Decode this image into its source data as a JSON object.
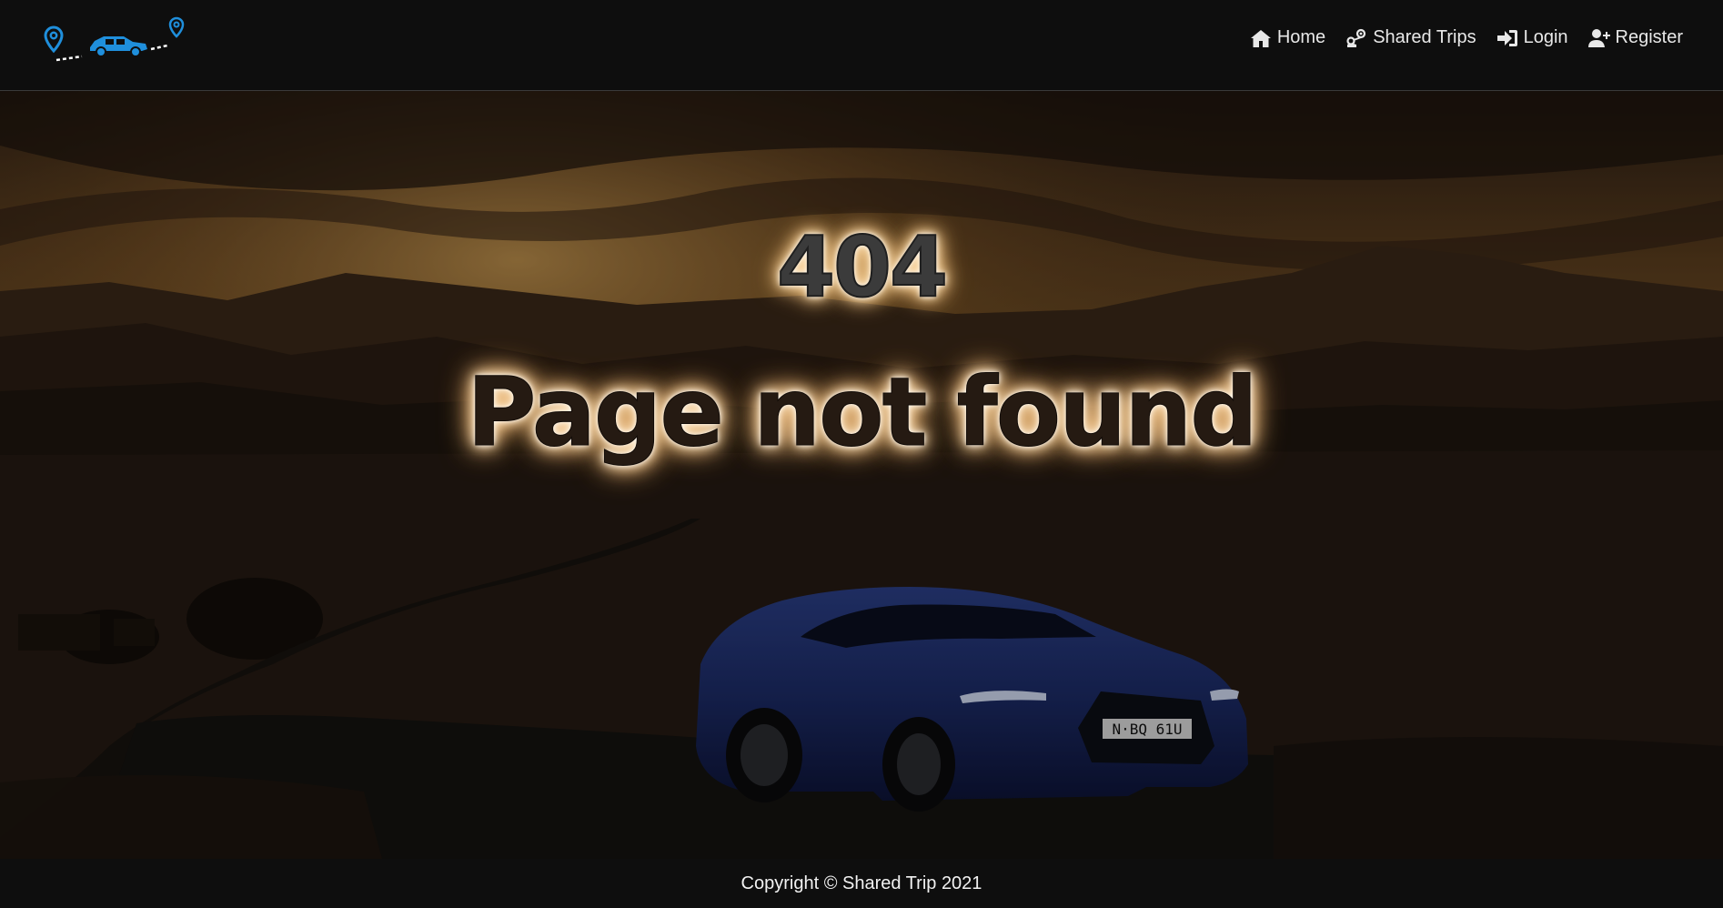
{
  "header": {
    "logo_icon": "route-car-logo-icon",
    "nav": [
      {
        "label": "Home",
        "icon": "home-icon"
      },
      {
        "label": "Shared Trips",
        "icon": "shared-trips-icon"
      },
      {
        "label": "Login",
        "icon": "login-icon"
      },
      {
        "label": "Register",
        "icon": "register-icon"
      }
    ]
  },
  "main": {
    "error_code": "404",
    "message": "Page not found",
    "background_image": "car-at-sunset-image"
  },
  "footer": {
    "copyright": "Copyright © Shared Trip 2021"
  },
  "colors": {
    "accent": "#1f8fdc",
    "navbar_bg": "#0e0e0e",
    "text": "#e8e8e8"
  }
}
